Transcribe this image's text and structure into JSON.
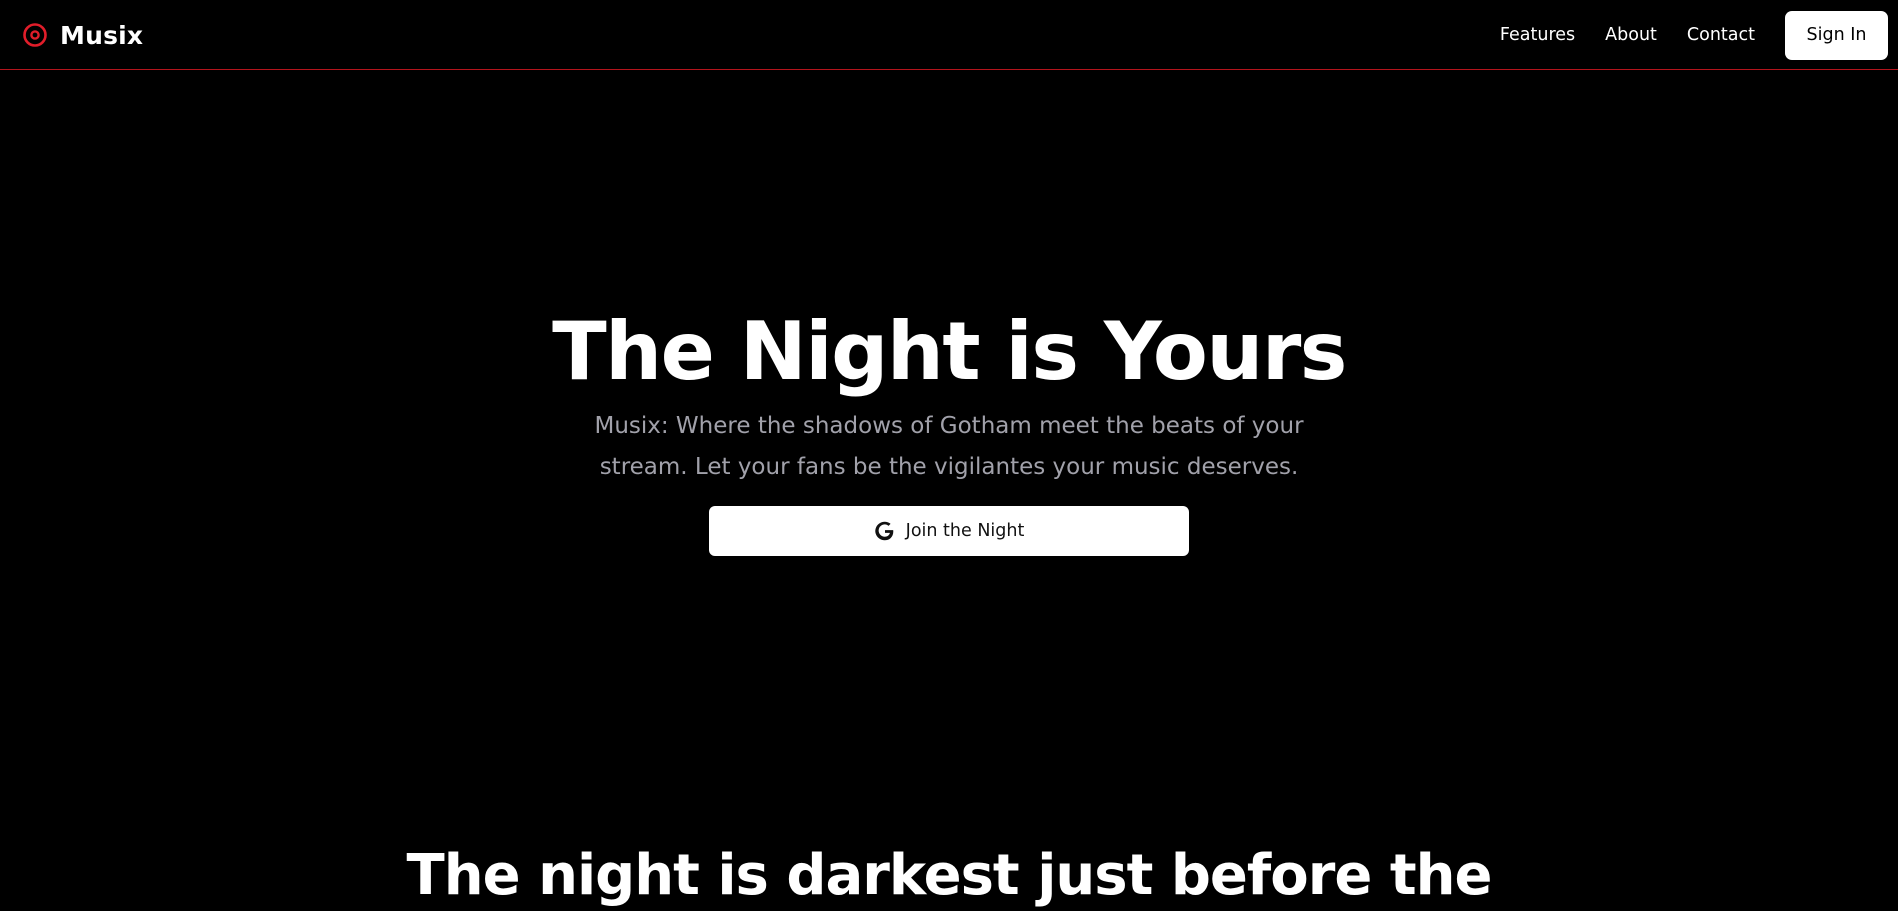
{
  "brand": {
    "name": "Musix",
    "icon": "record-icon",
    "accent_color": "#e11d2a"
  },
  "nav": {
    "links": [
      {
        "label": "Features"
      },
      {
        "label": "About"
      },
      {
        "label": "Contact"
      }
    ],
    "signin_label": "Sign In",
    "border_color": "#b3141c"
  },
  "hero": {
    "title": "The Night is Yours",
    "subtitle": "Musix: Where the shadows of Gotham meet the beats of your stream. Let your fans be the vigilantes your music deserves.",
    "cta_label": "Join the Night",
    "cta_icon": "google-icon"
  },
  "section": {
    "title": "The night is darkest just before the"
  }
}
